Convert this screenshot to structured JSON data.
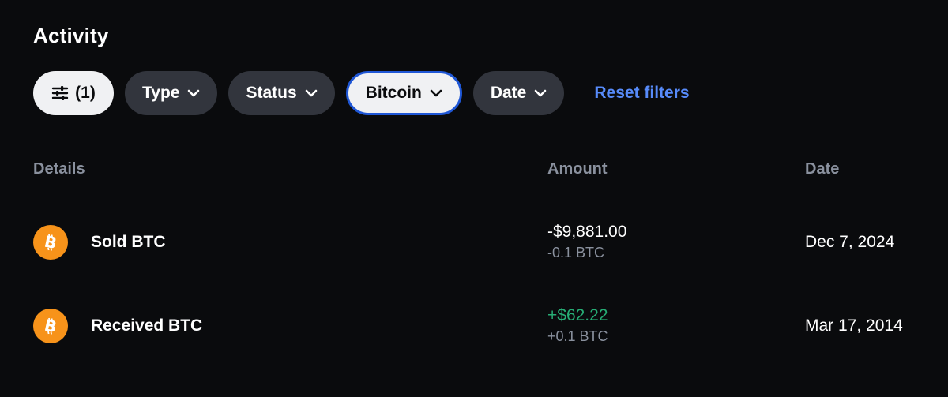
{
  "page": {
    "title": "Activity"
  },
  "filters": {
    "all_count": "(1)",
    "type_label": "Type",
    "status_label": "Status",
    "asset_label": "Bitcoin",
    "date_label": "Date",
    "reset_label": "Reset filters"
  },
  "table": {
    "headers": {
      "details": "Details",
      "amount": "Amount",
      "date": "Date"
    },
    "rows": [
      {
        "label": "Sold BTC",
        "fiat": "-$9,881.00",
        "crypto": "-0.1 BTC",
        "date": "Dec 7, 2024"
      },
      {
        "label": "Received BTC",
        "fiat": "+$62.22",
        "crypto": "+0.1 BTC",
        "date": "Mar 17, 2014"
      }
    ]
  },
  "icons": {
    "filter": "sliders-icon",
    "chevron": "chevron-down-icon",
    "coin": "bitcoin-icon"
  },
  "colors": {
    "background": "#0a0b0d",
    "chip": "#32353d",
    "chip_light": "#f0f1f3",
    "active_border": "#1f57d6",
    "link": "#578bfa",
    "positive": "#27ad75",
    "muted": "#8a919e",
    "bitcoin": "#f7931a"
  }
}
